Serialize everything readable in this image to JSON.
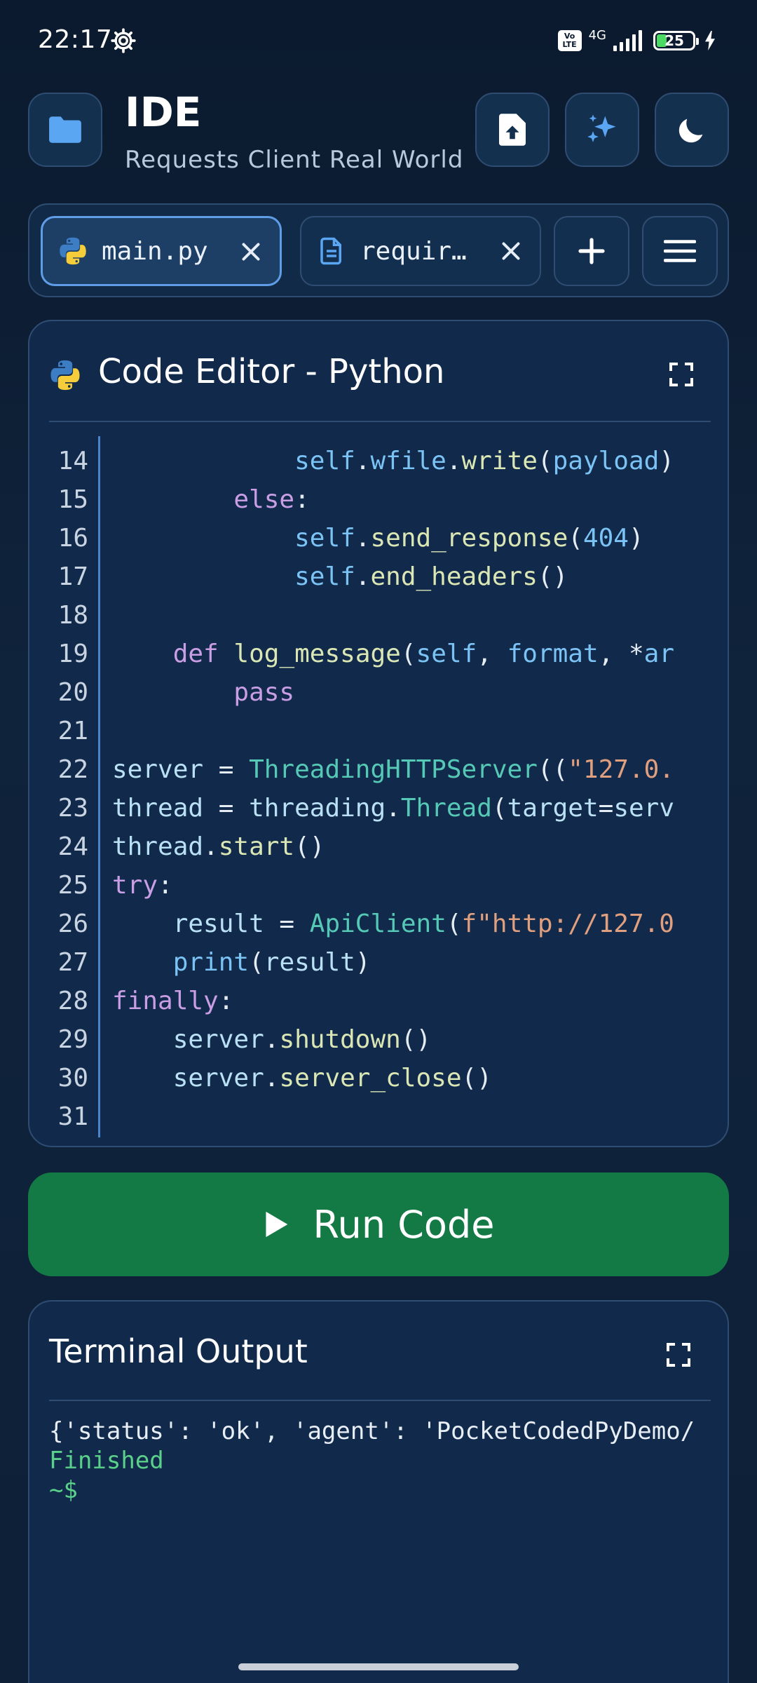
{
  "status_bar": {
    "time": "22:17",
    "network": "4G",
    "volte": "Vo LTE",
    "battery": "25"
  },
  "header": {
    "title": "IDE",
    "subtitle": "Requests Client Real World"
  },
  "tabs": [
    {
      "label": "main.py",
      "icon": "python-icon",
      "active": true
    },
    {
      "label": "requir…",
      "icon": "file-text-icon",
      "active": false
    }
  ],
  "editor": {
    "title": "Code Editor - Python",
    "lines": [
      {
        "n": "14",
        "tokens": [
          [
            "            ",
            ""
          ],
          [
            "self",
            "self"
          ],
          [
            ".",
            ""
          ],
          [
            "wfile",
            "self"
          ],
          [
            ".",
            ""
          ],
          [
            "write",
            "fn"
          ],
          [
            "(",
            ""
          ],
          [
            "payload",
            "param"
          ],
          [
            ")",
            ""
          ]
        ]
      },
      {
        "n": "15",
        "tokens": [
          [
            "        ",
            ""
          ],
          [
            "else",
            "kw"
          ],
          [
            ":",
            ""
          ]
        ]
      },
      {
        "n": "16",
        "tokens": [
          [
            "            ",
            ""
          ],
          [
            "self",
            "self"
          ],
          [
            ".",
            ""
          ],
          [
            "send_response",
            "fn"
          ],
          [
            "(",
            ""
          ],
          [
            "404",
            "num"
          ],
          [
            ")",
            ""
          ]
        ]
      },
      {
        "n": "17",
        "tokens": [
          [
            "            ",
            ""
          ],
          [
            "self",
            "self"
          ],
          [
            ".",
            ""
          ],
          [
            "end_headers",
            "fn"
          ],
          [
            "()",
            ""
          ]
        ]
      },
      {
        "n": "18",
        "tokens": []
      },
      {
        "n": "19",
        "tokens": [
          [
            "    ",
            ""
          ],
          [
            "def",
            "kw"
          ],
          [
            " ",
            ""
          ],
          [
            "log_message",
            "fn"
          ],
          [
            "(",
            ""
          ],
          [
            "self",
            "self"
          ],
          [
            ", ",
            ""
          ],
          [
            "format",
            "param"
          ],
          [
            ", *",
            ""
          ],
          [
            "ar",
            "param"
          ]
        ]
      },
      {
        "n": "20",
        "tokens": [
          [
            "        ",
            ""
          ],
          [
            "pass",
            "kw"
          ]
        ]
      },
      {
        "n": "21",
        "tokens": []
      },
      {
        "n": "22",
        "tokens": [
          [
            "server",
            "var"
          ],
          [
            " = ",
            ""
          ],
          [
            "ThreadingHTTPServer",
            "cls"
          ],
          [
            "((",
            ""
          ],
          [
            "\"127.0.",
            "str"
          ]
        ]
      },
      {
        "n": "23",
        "tokens": [
          [
            "thread",
            "var"
          ],
          [
            " = ",
            ""
          ],
          [
            "threading",
            "var"
          ],
          [
            ".",
            ""
          ],
          [
            "Thread",
            "cls"
          ],
          [
            "(",
            ""
          ],
          [
            "target",
            "var"
          ],
          [
            "=",
            ""
          ],
          [
            "serv",
            "var"
          ]
        ]
      },
      {
        "n": "24",
        "tokens": [
          [
            "thread",
            "var"
          ],
          [
            ".",
            ""
          ],
          [
            "start",
            "fn"
          ],
          [
            "()",
            ""
          ]
        ]
      },
      {
        "n": "25",
        "tokens": [
          [
            "try",
            "kw"
          ],
          [
            ":",
            ""
          ]
        ]
      },
      {
        "n": "26",
        "tokens": [
          [
            "    ",
            ""
          ],
          [
            "result",
            "var"
          ],
          [
            " = ",
            ""
          ],
          [
            "ApiClient",
            "cls"
          ],
          [
            "(",
            ""
          ],
          [
            "f\"http://127.0",
            "str"
          ]
        ]
      },
      {
        "n": "27",
        "tokens": [
          [
            "    ",
            ""
          ],
          [
            "print",
            "self"
          ],
          [
            "(",
            ""
          ],
          [
            "result",
            "var"
          ],
          [
            ")",
            ""
          ]
        ]
      },
      {
        "n": "28",
        "tokens": [
          [
            "finally",
            "kw"
          ],
          [
            ":",
            ""
          ]
        ]
      },
      {
        "n": "29",
        "tokens": [
          [
            "    ",
            ""
          ],
          [
            "server",
            "var"
          ],
          [
            ".",
            ""
          ],
          [
            "shutdown",
            "fn"
          ],
          [
            "()",
            ""
          ]
        ]
      },
      {
        "n": "30",
        "tokens": [
          [
            "    ",
            ""
          ],
          [
            "server",
            "var"
          ],
          [
            ".",
            ""
          ],
          [
            "server_close",
            "fn"
          ],
          [
            "()",
            ""
          ]
        ]
      },
      {
        "n": "31",
        "tokens": []
      }
    ]
  },
  "run_button": {
    "label": "Run Code"
  },
  "terminal": {
    "title": "Terminal Output",
    "output": "{'status': 'ok', 'agent': 'PocketCodedPyDemo/",
    "finished": "Finished",
    "prompt": "~$"
  },
  "colors": {
    "accent": "#5f9ee6",
    "run_green": "#147a45",
    "success_text": "#5bd08a",
    "background": "#0f233b"
  }
}
